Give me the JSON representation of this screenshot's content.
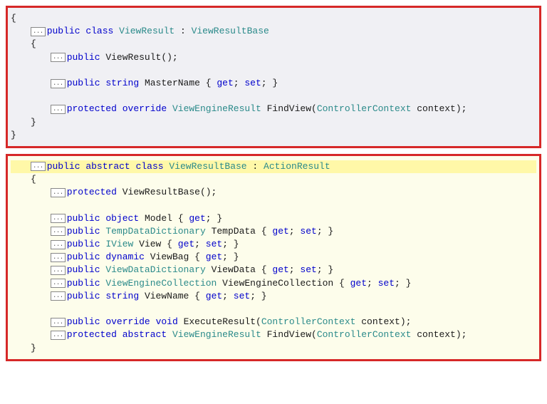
{
  "dots": "...",
  "top": {
    "open_brace": "{",
    "decl_kw1": "public",
    "decl_kw2": "class",
    "decl_name": "ViewResult",
    "decl_colon": " : ",
    "decl_base": "ViewResultBase",
    "inner_open": "{",
    "ctor_kw": "public",
    "ctor_sig": " ViewResult();",
    "prop_kw1": "public",
    "prop_kw2": "string",
    "prop_rest": " MasterName { ",
    "prop_get": "get",
    "prop_sep": "; ",
    "prop_set": "set",
    "prop_end": "; }",
    "m_kw1": "protected",
    "m_kw2": "override",
    "m_ret": "ViewEngineResult",
    "m_name": " FindView(",
    "m_ptype": "ControllerContext",
    "m_pname": " context);",
    "inner_close": "}",
    "close_brace": "}"
  },
  "bottom": {
    "decl_kw1": "public",
    "decl_kw2": "abstract",
    "decl_kw3": "class",
    "decl_name": "ViewResultBase",
    "decl_colon": " : ",
    "decl_base": "ActionResult",
    "open_brace": "{",
    "ctor_kw": "protected",
    "ctor_sig": " ViewResultBase();",
    "p1_kw1": "public",
    "p1_kw2": "object",
    "p1_rest": " Model { ",
    "p1_get": "get",
    "p1_end": "; }",
    "p2_kw1": "public",
    "p2_type": "TempDataDictionary",
    "p2_rest": " TempData { ",
    "p2_get": "get",
    "p2_sep": "; ",
    "p2_set": "set",
    "p2_end": "; }",
    "p3_kw1": "public",
    "p3_type": "IView",
    "p3_rest": " View { ",
    "p3_get": "get",
    "p3_sep": "; ",
    "p3_set": "set",
    "p3_end": "; }",
    "p4_kw1": "public",
    "p4_kw2": "dynamic",
    "p4_rest": " ViewBag { ",
    "p4_get": "get",
    "p4_end": "; }",
    "p5_kw1": "public",
    "p5_type": "ViewDataDictionary",
    "p5_rest": " ViewData { ",
    "p5_get": "get",
    "p5_sep": "; ",
    "p5_set": "set",
    "p5_end": "; }",
    "p6_kw1": "public",
    "p6_type": "ViewEngineCollection",
    "p6_rest": " ViewEngineCollection { ",
    "p6_get": "get",
    "p6_sep": "; ",
    "p6_set": "set",
    "p6_end": "; }",
    "p7_kw1": "public",
    "p7_kw2": "string",
    "p7_rest": " ViewName { ",
    "p7_get": "get",
    "p7_sep": "; ",
    "p7_set": "set",
    "p7_end": "; }",
    "m1_kw1": "public",
    "m1_kw2": "override",
    "m1_kw3": "void",
    "m1_name": " ExecuteResult(",
    "m1_ptype": "ControllerContext",
    "m1_pname": " context);",
    "m2_kw1": "protected",
    "m2_kw2": "abstract",
    "m2_ret": "ViewEngineResult",
    "m2_name": " FindView(",
    "m2_ptype": "ControllerContext",
    "m2_pname": " context);",
    "close_brace": "}"
  }
}
